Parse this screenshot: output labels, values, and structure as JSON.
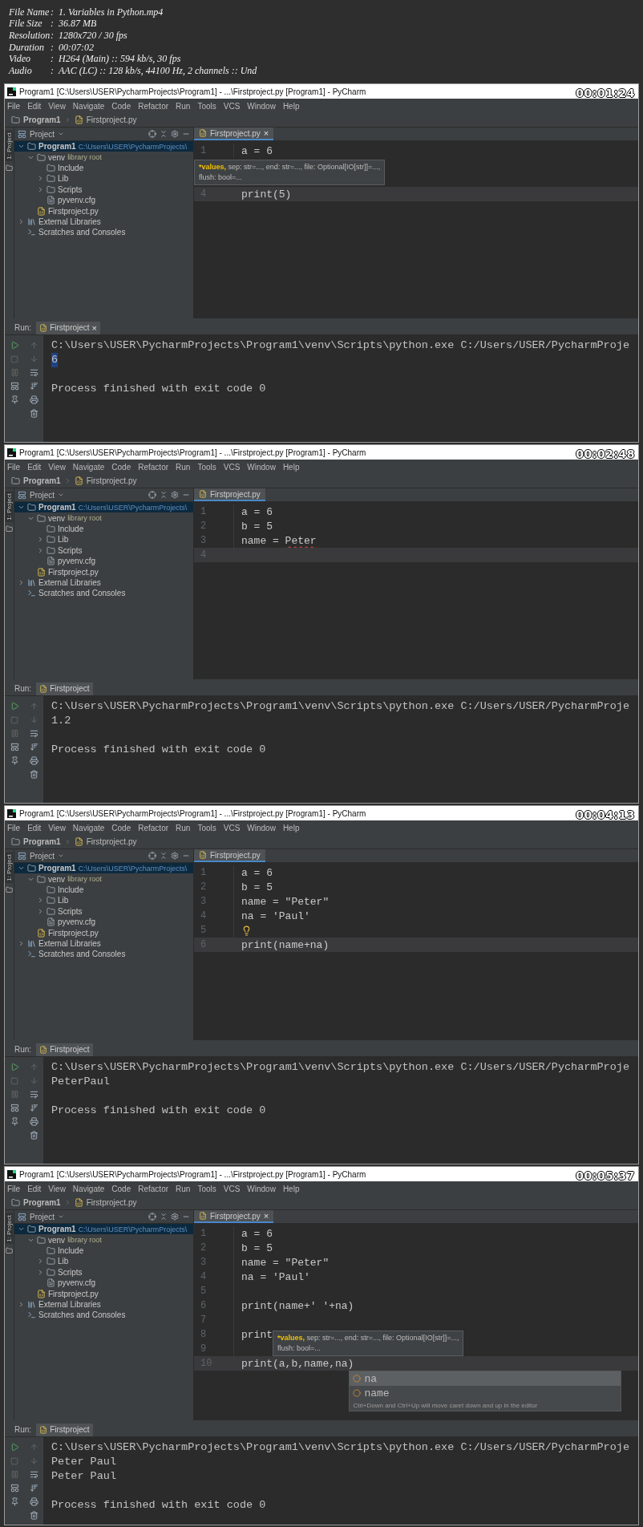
{
  "file_info": [
    {
      "label": "File Name",
      "separator": ":",
      "value": "1. Variables in Python.mp4"
    },
    {
      "label": "File Size",
      "separator": ":",
      "value": "36.87 MB"
    },
    {
      "label": "Resolution",
      "separator": ":",
      "value": "1280x720 / 30 fps"
    },
    {
      "label": "Duration",
      "separator": ":",
      "value": "00:07:02"
    },
    {
      "label": "Video",
      "separator": ":",
      "value": "H264 (Main) :: 594 kb/s, 30 fps"
    },
    {
      "label": "Audio",
      "separator": ":",
      "value": "AAC (LC) :: 128 kb/s, 44100 Hz, 2 channels :: Und"
    }
  ],
  "frames": [
    {
      "time": "00:01:24",
      "title": "Program1 [C:\\Users\\USER\\PycharmProjects\\Program1] - ...\\Firstproject.py [Program1] - PyCharm",
      "menu": [
        "File",
        "Edit",
        "View",
        "Navigate",
        "Code",
        "Refactor",
        "Run",
        "Tools",
        "VCS",
        "Window",
        "Help"
      ],
      "breadcrumbs": [
        "Program1",
        "Firstproject.py"
      ],
      "side_tab": "1: Project",
      "project_label": "Project",
      "tree": [
        {
          "label": "Program1",
          "path": "C:\\Users\\USER\\PycharmProjects\\",
          "kind": "folder",
          "expanded": true,
          "selected": true,
          "children": [
            {
              "label": "venv",
              "note": "library root",
              "kind": "folder",
              "expanded": true,
              "selected": false,
              "children": [
                {
                  "label": "Include",
                  "kind": "folder",
                  "selected": false
                },
                {
                  "label": "Lib",
                  "kind": "folder",
                  "expanded": false,
                  "selected": false
                },
                {
                  "label": "Scripts",
                  "kind": "folder",
                  "expanded": false,
                  "selected": false
                },
                {
                  "label": "pyvenv.cfg",
                  "kind": "file",
                  "selected": false
                }
              ]
            },
            {
              "label": "Firstproject.py",
              "kind": "python",
              "selected": false
            }
          ]
        },
        {
          "label": "External Libraries",
          "kind": "library",
          "expanded": false,
          "selected": false
        },
        {
          "label": "Scratches and Consoles",
          "kind": "scratch",
          "selected": false
        }
      ],
      "editor": {
        "tab": {
          "label": "Firstproject.py",
          "close": "×",
          "selected": true
        },
        "lines": [
          {
            "number": "1",
            "text": "a = 6"
          },
          {
            "hint": {
              "kind": "below",
              "param": "*values,",
              "text": "sep: str=..., end: str=..., file: Optional[IO[str]]=...,",
              "text2": "flush: bool=..."
            }
          },
          {
            "number": "4",
            "text": "print(5)",
            "current": true
          }
        ]
      },
      "run": {
        "label": "Run:",
        "tab": "Firstproject",
        "close": "×",
        "lines": [
          {
            "kind": "command",
            "text": "C:\\Users\\USER\\PycharmProjects\\Program1\\venv\\Scripts\\python.exe C:/Users/USER/PycharmProje"
          },
          {
            "kind": "output",
            "text": "6",
            "highlighted": true
          },
          {
            "kind": "exit",
            "text": "Process finished with exit code 0"
          }
        ]
      }
    },
    {
      "time": "00:02:48",
      "title": "Program1 [C:\\Users\\USER\\PycharmProjects\\Program1] - ...\\Firstproject.py [Program1] - PyCharm",
      "menu": [
        "File",
        "Edit",
        "View",
        "Navigate",
        "Code",
        "Refactor",
        "Run",
        "Tools",
        "VCS",
        "Window",
        "Help"
      ],
      "breadcrumbs": [
        "Program1",
        "Firstproject.py"
      ],
      "side_tab": "1: Project",
      "project_label": "Project",
      "tree": [
        {
          "label": "Program1",
          "path": "C:\\Users\\USER\\PycharmProjects\\",
          "kind": "folder",
          "expanded": true,
          "selected": true,
          "children": [
            {
              "label": "venv",
              "note": "library root",
              "kind": "folder",
              "expanded": true,
              "selected": false,
              "children": [
                {
                  "label": "Include",
                  "kind": "folder",
                  "selected": false
                },
                {
                  "label": "Lib",
                  "kind": "folder",
                  "expanded": false,
                  "selected": false
                },
                {
                  "label": "Scripts",
                  "kind": "folder",
                  "expanded": false,
                  "selected": false
                },
                {
                  "label": "pyvenv.cfg",
                  "kind": "file",
                  "selected": false
                }
              ]
            },
            {
              "label": "Firstproject.py",
              "kind": "python",
              "selected": false
            }
          ]
        },
        {
          "label": "External Libraries",
          "kind": "library",
          "expanded": false,
          "selected": false
        },
        {
          "label": "Scratches and Consoles",
          "kind": "scratch",
          "selected": false
        }
      ],
      "editor": {
        "tab": {
          "label": "Firstproject.py",
          "selected": true
        },
        "lines": [
          {
            "number": "1",
            "text": "a = 6"
          },
          {
            "number": "2",
            "text": "b = 5"
          },
          {
            "number": "3",
            "text": "name = ",
            "squiggle": "Peter"
          },
          {
            "number": "4",
            "current": true
          }
        ]
      },
      "run": {
        "label": "Run:",
        "tab": "Firstproject",
        "lines": [
          {
            "kind": "command",
            "text": "C:\\Users\\USER\\PycharmProjects\\Program1\\venv\\Scripts\\python.exe C:/Users/USER/PycharmProje"
          },
          {
            "kind": "output",
            "text": "1.2",
            "highlighted": false
          },
          {
            "kind": "exit",
            "text": "Process finished with exit code 0"
          }
        ]
      }
    },
    {
      "time": "00:04:13",
      "title": "Program1 [C:\\Users\\USER\\PycharmProjects\\Program1] - ...\\Firstproject.py [Program1] - PyCharm",
      "menu": [
        "File",
        "Edit",
        "View",
        "Navigate",
        "Code",
        "Refactor",
        "Run",
        "Tools",
        "VCS",
        "Window",
        "Help"
      ],
      "breadcrumbs": [
        "Program1",
        "Firstproject.py"
      ],
      "side_tab": "1: Project",
      "project_label": "Project",
      "tree": [
        {
          "label": "Program1",
          "path": "C:\\Users\\USER\\PycharmProjects\\",
          "kind": "folder",
          "expanded": true,
          "selected": true,
          "children": [
            {
              "label": "venv",
              "note": "library root",
              "kind": "folder",
              "expanded": true,
              "selected": false,
              "children": [
                {
                  "label": "Include",
                  "kind": "folder",
                  "selected": false
                },
                {
                  "label": "Lib",
                  "kind": "folder",
                  "expanded": false,
                  "selected": false
                },
                {
                  "label": "Scripts",
                  "kind": "folder",
                  "expanded": false,
                  "selected": false
                },
                {
                  "label": "pyvenv.cfg",
                  "kind": "file",
                  "selected": false
                }
              ]
            },
            {
              "label": "Firstproject.py",
              "kind": "python",
              "selected": false
            }
          ]
        },
        {
          "label": "External Libraries",
          "kind": "library",
          "expanded": false,
          "selected": false
        },
        {
          "label": "Scratches and Consoles",
          "kind": "scratch",
          "selected": false
        }
      ],
      "editor": {
        "tab": {
          "label": "Firstproject.py",
          "selected": true
        },
        "lines": [
          {
            "number": "1",
            "text": "a = 6"
          },
          {
            "number": "2",
            "text": "b = 5"
          },
          {
            "number": "3",
            "text": "name = \"Peter\""
          },
          {
            "number": "4",
            "text": "na = 'Paul'"
          },
          {
            "number": "5",
            "bulb": true
          },
          {
            "number": "6",
            "text": "print(name+na)",
            "current": true
          }
        ]
      },
      "run": {
        "label": "Run:",
        "tab": "Firstproject",
        "lines": [
          {
            "kind": "command",
            "text": "C:\\Users\\USER\\PycharmProjects\\Program1\\venv\\Scripts\\python.exe C:/Users/USER/PycharmProje"
          },
          {
            "kind": "output",
            "text": "PeterPaul",
            "highlighted": false
          },
          {
            "kind": "exit",
            "text": "Process finished with exit code 0"
          }
        ]
      }
    },
    {
      "time": "00:05:37",
      "title": "Program1 [C:\\Users\\USER\\PycharmProjects\\Program1] - ...\\Firstproject.py [Program1] - PyCharm",
      "menu": [
        "File",
        "Edit",
        "View",
        "Navigate",
        "Code",
        "Refactor",
        "Run",
        "Tools",
        "VCS",
        "Window",
        "Help"
      ],
      "breadcrumbs": [
        "Program1",
        "Firstproject.py"
      ],
      "side_tab": "1: Project",
      "project_label": "Project",
      "tree": [
        {
          "label": "Program1",
          "path": "C:\\Users\\USER\\PycharmProjects\\",
          "kind": "folder",
          "expanded": true,
          "selected": true,
          "children": [
            {
              "label": "venv",
              "note": "library root",
              "kind": "folder",
              "expanded": true,
              "selected": false,
              "children": [
                {
                  "label": "Include",
                  "kind": "folder",
                  "selected": false
                },
                {
                  "label": "Lib",
                  "kind": "folder",
                  "expanded": false,
                  "selected": false
                },
                {
                  "label": "Scripts",
                  "kind": "folder",
                  "expanded": false,
                  "selected": false
                },
                {
                  "label": "pyvenv.cfg",
                  "kind": "file",
                  "selected": false
                }
              ]
            },
            {
              "label": "Firstproject.py",
              "kind": "python",
              "selected": false
            }
          ]
        },
        {
          "label": "External Libraries",
          "kind": "library",
          "expanded": false,
          "selected": false
        },
        {
          "label": "Scratches and Consoles",
          "kind": "scratch",
          "selected": false
        }
      ],
      "editor": {
        "tab": {
          "label": "Firstproject.py",
          "close": "×",
          "selected": true
        },
        "lines": [
          {
            "number": "1",
            "text": "a = 6"
          },
          {
            "number": "2",
            "text": "b = 5"
          },
          {
            "number": "3",
            "text": "name = \"Peter\""
          },
          {
            "number": "4",
            "text": "na = 'Paul'"
          },
          {
            "number": "5"
          },
          {
            "number": "6",
            "text": "print(name+' '+na)"
          },
          {
            "number": "7"
          },
          {
            "number": "8",
            "text": "print",
            "hint": {
              "kind": "beside",
              "param": "*values,",
              "text": "sep: str=..., end: str=..., file: Optional[IO[str]]=...,",
              "text2": "flush: bool=..."
            }
          },
          {
            "number": "9"
          },
          {
            "number": "10",
            "text": "print(a,b,name,na)",
            "current": true,
            "completion": {
              "items": [
                {
                  "label": "na",
                  "selected": true
                },
                {
                  "label": "name",
                  "selected": false
                }
              ],
              "footer": "Ctrl+Down and Ctrl+Up will move caret down and up in the editor"
            }
          }
        ]
      },
      "run": {
        "label": "Run:",
        "tab": "Firstproject",
        "lines": [
          {
            "kind": "command",
            "text": "C:\\Users\\USER\\PycharmProjects\\Program1\\venv\\Scripts\\python.exe C:/Users/USER/PycharmProje"
          },
          {
            "kind": "output",
            "text": "Peter Paul",
            "highlighted": false
          },
          {
            "kind": "output",
            "text": "Peter Paul",
            "highlighted": false
          },
          {
            "kind": "exit",
            "text": "Process finished with exit code 0"
          }
        ]
      }
    }
  ]
}
